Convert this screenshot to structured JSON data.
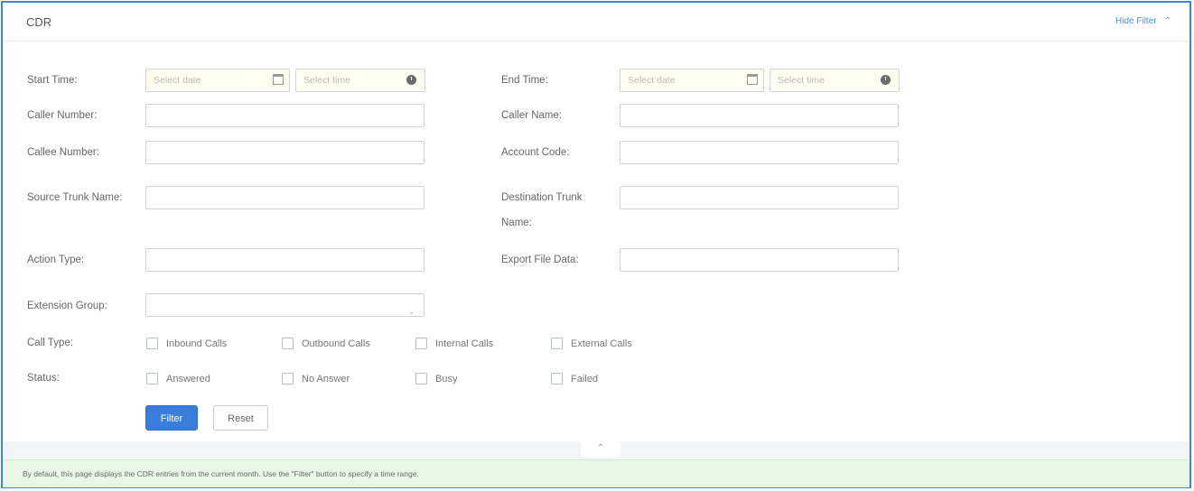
{
  "header": {
    "title": "CDR",
    "hide_filter": "Hide Filter"
  },
  "labels": {
    "start_time": "Start Time:",
    "end_time": "End Time:",
    "caller_number": "Caller Number:",
    "caller_name": "Caller Name:",
    "callee_number": "Callee Number:",
    "account_code": "Account Code:",
    "source_trunk": "Source Trunk Name:",
    "dest_trunk_1": "Destination Trunk",
    "dest_trunk_2": "Name:",
    "action_type": "Action Type:",
    "export_file": "Export File Data:",
    "extension_group": "Extension Group:",
    "call_type": "Call Type:",
    "status": "Status:"
  },
  "placeholders": {
    "date": "Select date",
    "time": "Select time"
  },
  "call_types": [
    "Inbound Calls",
    "Outbound Calls",
    "Internal Calls",
    "External Calls"
  ],
  "statuses": [
    "Answered",
    "No Answer",
    "Busy",
    "Failed"
  ],
  "buttons": {
    "filter": "Filter",
    "reset": "Reset"
  },
  "notice": "By default, this page displays the CDR entries from the current month. Use the \"Filter\" button to specify a time range.",
  "colors": {
    "accent": "#3b7ddb",
    "frame": "#3b86d6",
    "notice_bg": "#e9f7e7"
  }
}
